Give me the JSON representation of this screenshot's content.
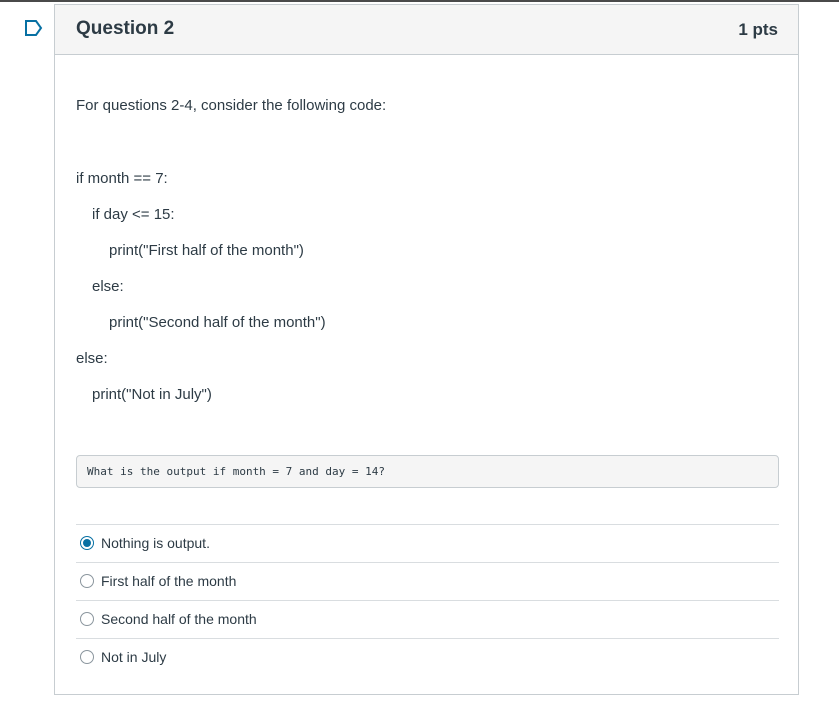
{
  "question": {
    "title": "Question 2",
    "points": "1 pts",
    "intro": "For questions 2-4, consider the following code:",
    "code_lines": [
      "if month == 7:",
      "if day <= 15:",
      "print(\"First half of the month\")",
      "else:",
      "print(\"Second half of the month\")",
      "else:",
      "print(\"Not in July\")"
    ],
    "prompt": "What is the output if month = 7 and day = 14?",
    "answers": [
      {
        "label": "Nothing is output.",
        "selected": true
      },
      {
        "label": "First half of the month",
        "selected": false
      },
      {
        "label": "Second half of the month",
        "selected": false
      },
      {
        "label": "Not in July",
        "selected": false
      }
    ]
  },
  "colors": {
    "accent": "#0770a3",
    "text": "#2d3b45",
    "border": "#c7cdd1"
  },
  "icons": {
    "flag": "flag-icon"
  }
}
